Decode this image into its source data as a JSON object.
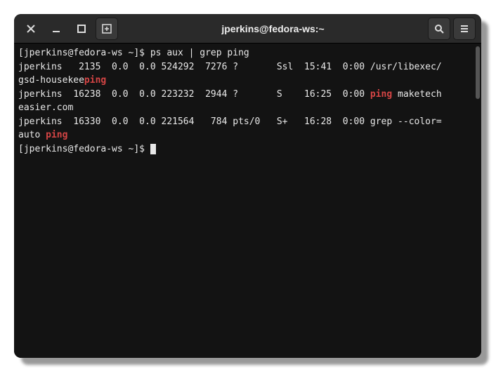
{
  "titlebar": {
    "title": "jperkins@fedora-ws:~"
  },
  "terminal": {
    "prompt": "[jperkins@fedora-ws ~]$ ",
    "command": "ps aux | grep ping",
    "rows": [
      {
        "user": "jperkins",
        "pid": "2135",
        "cpu": "0.0",
        "mem": "0.0",
        "vsz": "524292",
        "rss": "7276",
        "tty": "?",
        "stat": "Ssl",
        "start": "15:41",
        "time": "0:00",
        "cmd_pre": "/usr/libexec/gsd-housekee",
        "cmd_hl": "ping",
        "cmd_post": ""
      },
      {
        "user": "jperkins",
        "pid": "16238",
        "cpu": "0.0",
        "mem": "0.0",
        "vsz": "223232",
        "rss": "2944",
        "tty": "?",
        "stat": "S",
        "start": "16:25",
        "time": "0:00",
        "cmd_pre": "",
        "cmd_hl": "ping",
        "cmd_post": " maketecheasier.com"
      },
      {
        "user": "jperkins",
        "pid": "16330",
        "cpu": "0.0",
        "mem": "0.0",
        "vsz": "221564",
        "rss": "784",
        "tty": "pts/0",
        "stat": "S+",
        "start": "16:28",
        "time": "0:00",
        "cmd_pre": "grep --color=auto ",
        "cmd_hl": "ping",
        "cmd_post": ""
      }
    ],
    "lines": {
      "l1": "jperkins   2135  0.0  0.0 524292  7276 ?       Ssl  15:41  0:00 /usr/libexec/",
      "l1b_pre": "gsd-housekee",
      "l1b_hl": "ping",
      "l2a": "jperkins  16238  0.0  0.0 223232  2944 ?       S    16:25  0:00 ",
      "l2a_hl": "ping",
      "l2a_post": " maketech",
      "l2b": "easier.com",
      "l3a": "jperkins  16330  0.0  0.0 221564   784 pts/0   S+   16:28  0:00 grep --color=",
      "l3b_pre": "auto ",
      "l3b_hl": "ping"
    }
  }
}
